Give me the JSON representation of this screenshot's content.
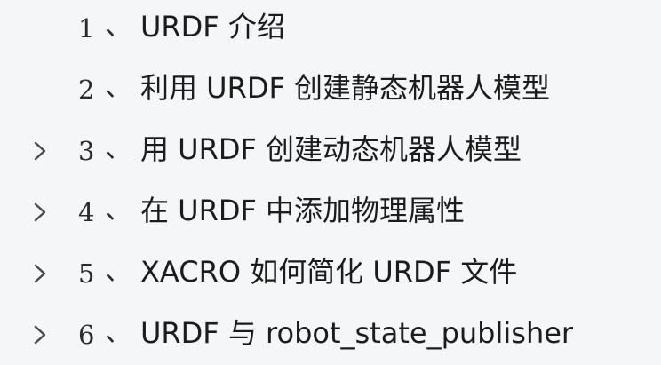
{
  "toc": {
    "items": [
      {
        "number": "1",
        "separator": "、",
        "title": "URDF 介绍",
        "expandable": false
      },
      {
        "number": "2",
        "separator": "、",
        "title": "利用 URDF 创建静态机器人模型",
        "expandable": false
      },
      {
        "number": "3",
        "separator": "、",
        "title": "用 URDF 创建动态机器人模型",
        "expandable": true
      },
      {
        "number": "4",
        "separator": "、",
        "title": "在 URDF 中添加物理属性",
        "expandable": true
      },
      {
        "number": "5",
        "separator": "、",
        "title": "XACRO 如何简化 URDF 文件",
        "expandable": true
      },
      {
        "number": "6",
        "separator": "、",
        "title": "URDF 与 robot_state_publisher",
        "expandable": true
      }
    ]
  },
  "icons": {
    "expand": "chevron-right-icon"
  },
  "colors": {
    "background": "#f4f6f7",
    "text": "#1c1c1c",
    "chevron": "#4a4a4a"
  }
}
